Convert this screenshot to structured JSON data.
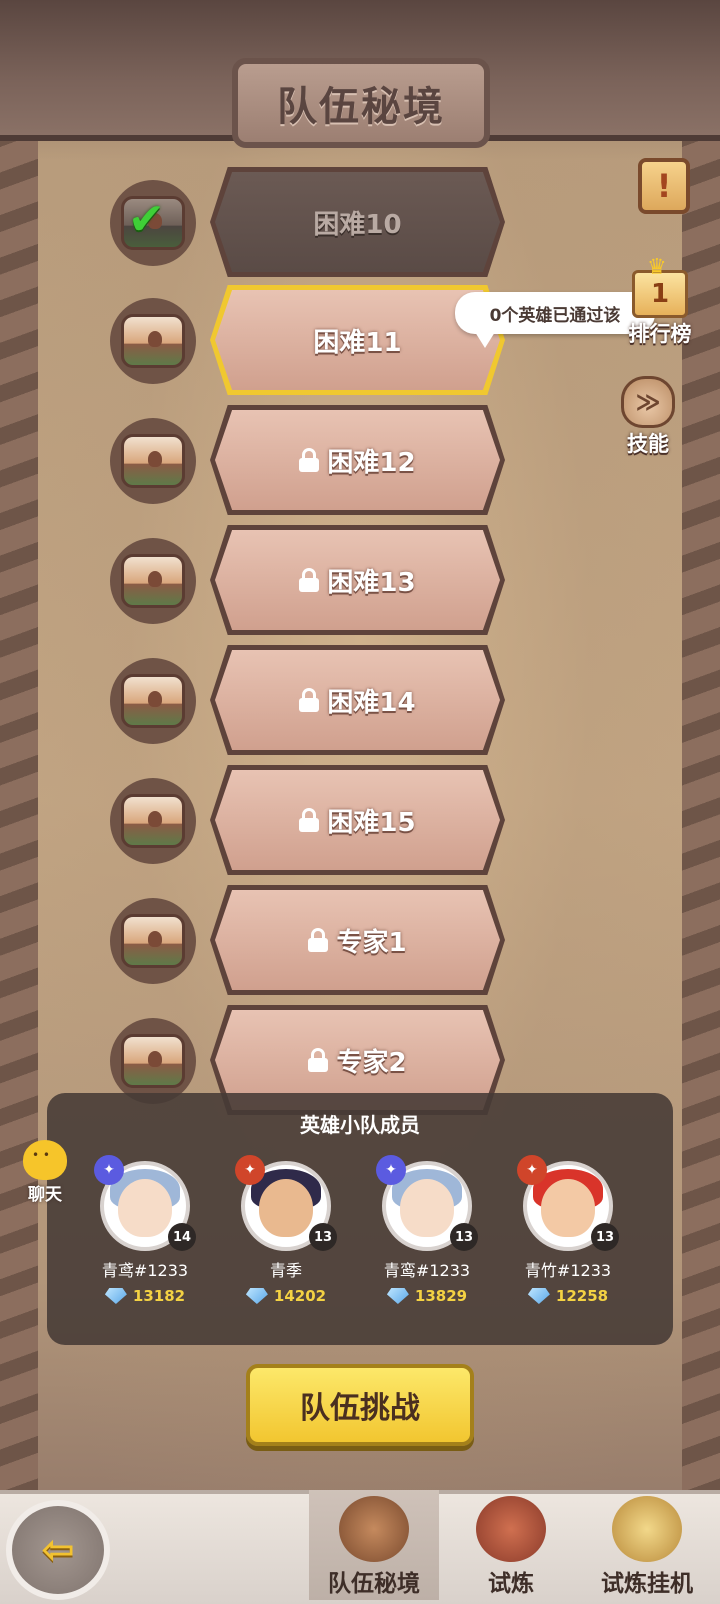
{
  "title": "队伍秘境",
  "stages": [
    {
      "label": "困难10",
      "state": "cleared"
    },
    {
      "label": "困难11",
      "state": "current"
    },
    {
      "label": "困难12",
      "state": "locked"
    },
    {
      "label": "困难13",
      "state": "locked"
    },
    {
      "label": "困难14",
      "state": "locked"
    },
    {
      "label": "困难15",
      "state": "locked"
    },
    {
      "label": "专家1",
      "state": "locked"
    },
    {
      "label": "专家2",
      "state": "locked"
    }
  ],
  "tooltip": "0个英雄已通过该",
  "side": {
    "notice_icon": "notice-scroll-icon",
    "rank_label": "排行榜",
    "rank_number": "1",
    "skill_label": "技能"
  },
  "team": {
    "title": "英雄小队成员",
    "members": [
      {
        "name": "青鸢#1233",
        "level": "14",
        "power": "13182"
      },
      {
        "name": "青季",
        "level": "13",
        "power": "14202"
      },
      {
        "name": "青鸾#1233",
        "level": "13",
        "power": "13829"
      },
      {
        "name": "青竹#1233",
        "level": "13",
        "power": "12258"
      }
    ]
  },
  "chat_label": "聊天",
  "challenge_label": "队伍挑战",
  "tabs": [
    "队伍秘境",
    "试炼",
    "试炼挂机"
  ],
  "colors": {
    "accent_yellow": "#f2c630",
    "cleared_check": "#3fcf37",
    "power_text": "#f4d243"
  }
}
